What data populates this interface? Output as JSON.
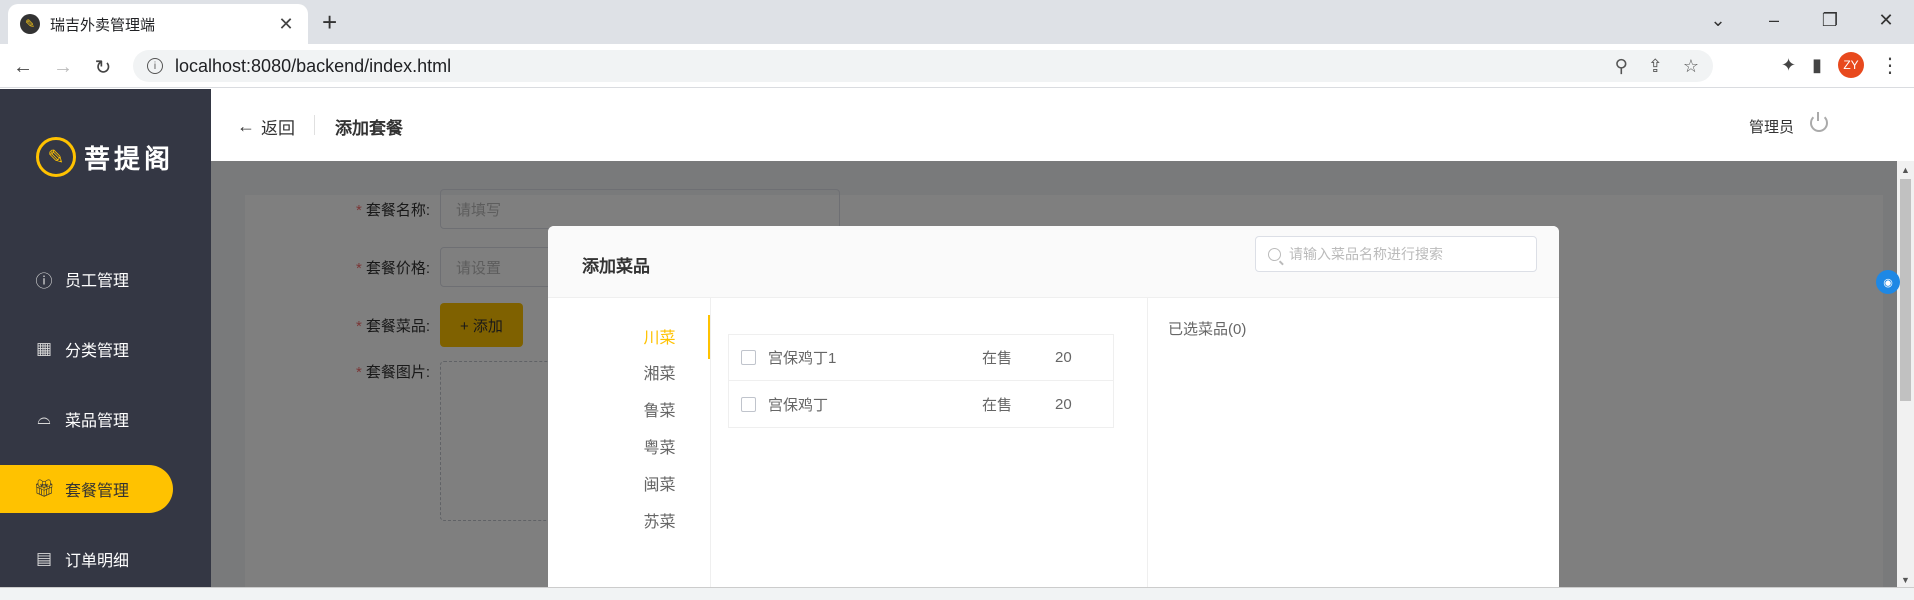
{
  "browser": {
    "tab_title": "瑞吉外卖管理端",
    "url": "localhost:8080/backend/index.html",
    "profile_initials": "ZY"
  },
  "sidebar": {
    "logo_text": "菩提阁",
    "items": [
      {
        "label": "员工管理",
        "icon": "info-icon"
      },
      {
        "label": "分类管理",
        "icon": "grid-icon"
      },
      {
        "label": "菜品管理",
        "icon": "cloche-icon"
      },
      {
        "label": "套餐管理",
        "icon": "gift-icon",
        "active": true
      },
      {
        "label": "订单明细",
        "icon": "clipboard-icon"
      }
    ]
  },
  "header": {
    "back_label": "返回",
    "page_title": "添加套餐",
    "user_label": "管理员"
  },
  "form": {
    "name_label": "套餐名称:",
    "name_placeholder": "请填写",
    "price_label": "套餐价格:",
    "price_placeholder": "请设置",
    "dishes_label": "套餐菜品:",
    "add_dish_button": "+ 添加",
    "image_label": "套餐图片:"
  },
  "dialog": {
    "title": "添加菜品",
    "search_placeholder": "请输入菜品名称进行搜索",
    "categories": [
      "川菜",
      "湘菜",
      "鲁菜",
      "粤菜",
      "闽菜",
      "苏菜"
    ],
    "active_category": "川菜",
    "dishes": [
      {
        "name": "宫保鸡丁1",
        "status": "在售",
        "price": "20"
      },
      {
        "name": "宫保鸡丁",
        "status": "在售",
        "price": "20"
      }
    ],
    "selected_label": "已选菜品(0)"
  },
  "colors": {
    "accent": "#ffc200",
    "sidebar_bg": "#343744",
    "required": "#f56c6c"
  }
}
